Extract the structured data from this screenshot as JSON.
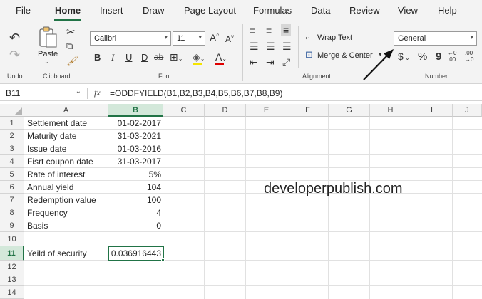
{
  "tabs": [
    "File",
    "Home",
    "Insert",
    "Draw",
    "Page Layout",
    "Formulas",
    "Data",
    "Review",
    "View",
    "Help"
  ],
  "ribbon": {
    "groups": {
      "undo": "Undo",
      "clipboard": "Clipboard",
      "font": "Font",
      "alignment": "Alignment",
      "number": "Number"
    },
    "paste_label": "Paste",
    "font_name": "Calibri",
    "font_size": "11",
    "wrap_text": "Wrap Text",
    "merge_center": "Merge & Center",
    "number_format": "General",
    "bold": "B",
    "italic": "I",
    "underline": "U",
    "double_underline": "D",
    "strike": "ab",
    "grow_font": "A",
    "shrink_font": "A",
    "font_color": "A",
    "currency": "$",
    "percent": "%",
    "comma": "9",
    "inc_decimal": "←0 .00",
    "dec_decimal": ".00 →0"
  },
  "formula_bar": {
    "name_box": "B11",
    "fx": "fx",
    "formula": "=ODDFYIELD(B1,B2,B3,B4,B5,B6,B7,B8,B9)"
  },
  "columns": [
    "A",
    "B",
    "C",
    "D",
    "E",
    "F",
    "G",
    "H",
    "I",
    "J"
  ],
  "rows": [
    "1",
    "2",
    "3",
    "4",
    "5",
    "6",
    "7",
    "8",
    "9",
    "10",
    "11",
    "12",
    "13",
    "14"
  ],
  "cells": {
    "labels": [
      "Settlement date",
      "Maturity date",
      "Issue date",
      "Fisrt coupon date",
      "Rate of interest",
      "Annual yield",
      "Redemption value",
      "Frequency",
      "Basis",
      "",
      "Yeild of security"
    ],
    "values": [
      "01-02-2017",
      "31-03-2021",
      "01-03-2016",
      "31-03-2017",
      "5%",
      "104",
      "100",
      "4",
      "0",
      "",
      "0.036916443"
    ]
  },
  "watermark": "developerpublish.com",
  "colors": {
    "accent": "#217346",
    "selected_header": "#d3e8da"
  }
}
